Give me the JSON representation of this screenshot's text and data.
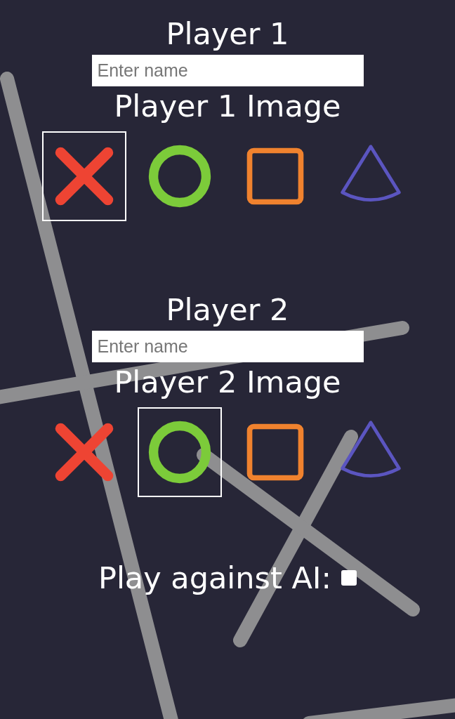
{
  "players": [
    {
      "title": "Player 1",
      "placeholder": "Enter name",
      "image_label": "Player 1 Image",
      "images": [
        {
          "kind": "cross",
          "selected": true
        },
        {
          "kind": "circle",
          "selected": false
        },
        {
          "kind": "square",
          "selected": false
        },
        {
          "kind": "cone",
          "selected": false
        }
      ]
    },
    {
      "title": "Player 2",
      "placeholder": "Enter name",
      "image_label": "Player 2 Image",
      "images": [
        {
          "kind": "cross",
          "selected": false
        },
        {
          "kind": "circle",
          "selected": true
        },
        {
          "kind": "square",
          "selected": false
        },
        {
          "kind": "cone",
          "selected": false
        }
      ]
    }
  ],
  "ai": {
    "label": "Play against AI:",
    "checked": false
  }
}
